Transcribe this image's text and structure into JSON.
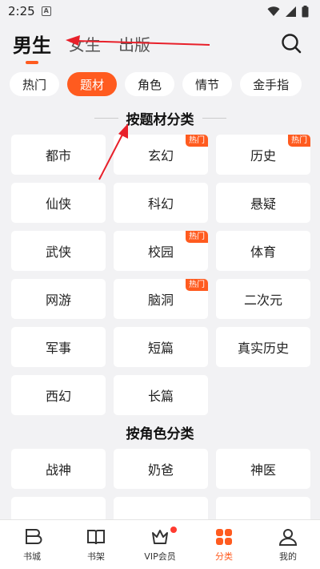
{
  "status_bar": {
    "time": "2:25",
    "notification_icon": "a-square-icon",
    "icons": [
      "wifi-icon",
      "signal-icon",
      "battery-icon"
    ]
  },
  "top_tabs": [
    {
      "label": "男生",
      "active": true
    },
    {
      "label": "女生",
      "active": false
    },
    {
      "label": "出版",
      "active": false
    }
  ],
  "pills": [
    {
      "label": "热门",
      "active": false
    },
    {
      "label": "题材",
      "active": true
    },
    {
      "label": "角色",
      "active": false
    },
    {
      "label": "情节",
      "active": false
    },
    {
      "label": "金手指",
      "active": false
    }
  ],
  "sections": [
    {
      "title": "按题材分类",
      "items": [
        {
          "label": "都市",
          "badge": ""
        },
        {
          "label": "玄幻",
          "badge": "热门"
        },
        {
          "label": "历史",
          "badge": "热门"
        },
        {
          "label": "仙侠",
          "badge": ""
        },
        {
          "label": "科幻",
          "badge": ""
        },
        {
          "label": "悬疑",
          "badge": ""
        },
        {
          "label": "武侠",
          "badge": ""
        },
        {
          "label": "校园",
          "badge": "热门"
        },
        {
          "label": "体育",
          "badge": ""
        },
        {
          "label": "网游",
          "badge": ""
        },
        {
          "label": "脑洞",
          "badge": "热门"
        },
        {
          "label": "二次元",
          "badge": ""
        },
        {
          "label": "军事",
          "badge": ""
        },
        {
          "label": "短篇",
          "badge": ""
        },
        {
          "label": "真实历史",
          "badge": ""
        },
        {
          "label": "西幻",
          "badge": ""
        },
        {
          "label": "长篇",
          "badge": ""
        }
      ]
    },
    {
      "title": "按角色分类",
      "items": [
        {
          "label": "战神",
          "badge": ""
        },
        {
          "label": "奶爸",
          "badge": ""
        },
        {
          "label": "神医",
          "badge": ""
        },
        {
          "label": "",
          "badge": ""
        },
        {
          "label": "",
          "badge": ""
        },
        {
          "label": "",
          "badge": ""
        }
      ]
    }
  ],
  "bottom_nav": [
    {
      "label": "书城",
      "icon": "bookstore-icon",
      "active": false
    },
    {
      "label": "书架",
      "icon": "bookshelf-icon",
      "active": false
    },
    {
      "label": "VIP会员",
      "icon": "crown-icon",
      "active": false,
      "dot": true
    },
    {
      "label": "分类",
      "icon": "category-icon",
      "active": true
    },
    {
      "label": "我的",
      "icon": "profile-icon",
      "active": false
    }
  ],
  "colors": {
    "accent": "#ff5b1f",
    "annotation": "#e8202a"
  }
}
